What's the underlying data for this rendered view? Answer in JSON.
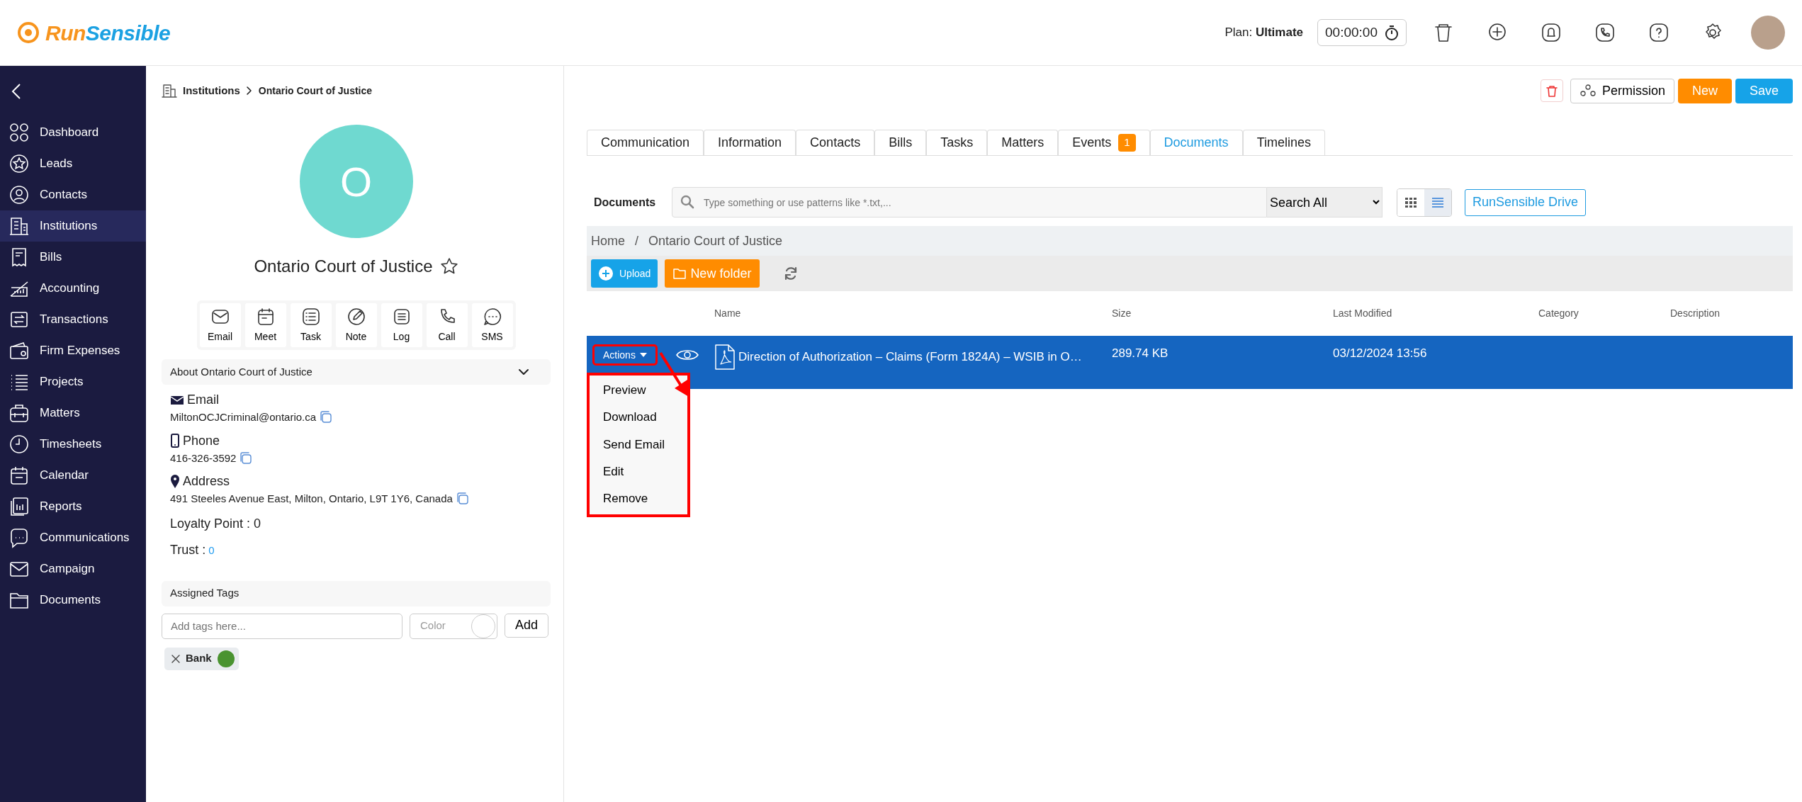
{
  "header": {
    "logo_parts": [
      {
        "text": "Run",
        "color": "#f7941d"
      },
      {
        "text": "Sensible",
        "color": "#1ba1e2"
      }
    ],
    "plan": "Plan: **Ultimate**",
    "timer": "00:00:00"
  },
  "sidebar": {
    "items": [
      {
        "label": "Dashboard",
        "selected": false
      },
      {
        "label": "Leads",
        "selected": false
      },
      {
        "label": "Contacts",
        "selected": false
      },
      {
        "label": "Institutions",
        "selected": true
      },
      {
        "label": "Bills",
        "selected": false
      },
      {
        "label": "Accounting",
        "selected": false
      },
      {
        "label": "Transactions",
        "selected": false
      },
      {
        "label": "Firm Expenses",
        "selected": false
      },
      {
        "label": "Projects",
        "selected": false
      },
      {
        "label": "Matters",
        "selected": false
      },
      {
        "label": "Timesheets",
        "selected": false
      },
      {
        "label": "Calendar",
        "selected": false
      },
      {
        "label": "Reports",
        "selected": false
      },
      {
        "label": "Communications",
        "selected": false
      },
      {
        "label": "Campaign",
        "selected": false
      },
      {
        "label": "Documents",
        "selected": false
      }
    ]
  },
  "breadcrumb": [
    "Institutions",
    "Ontario Court of Justice"
  ],
  "profile": {
    "initial": "O",
    "name": "Ontario Court of Justice",
    "quick_actions": [
      "Email",
      "Meet",
      "Task",
      "Note",
      "Log",
      "Call",
      "SMS"
    ],
    "about_title": "About Ontario Court of Justice",
    "fields": [
      {
        "kind": "email",
        "label": "Email",
        "value": "MiltonOCJCriminal@ontario.ca"
      },
      {
        "kind": "phone",
        "label": "Phone",
        "value": "416-326-3592"
      },
      {
        "kind": "address",
        "label": "Address",
        "value": "491 Steeles Avenue East, Milton, Ontario, L9T 1Y6, Canada"
      }
    ],
    "loyalty": "Loyalty Point : 0",
    "trust_label": "Trust :",
    "trust_value": "0",
    "tags_title": "Assigned Tags",
    "tag_placeholder": "Add tags here...",
    "color_placeholder": "Color",
    "add_button": "Add",
    "tags": [
      {
        "label": "Bank",
        "color": "#4a9330"
      }
    ]
  },
  "actions": {
    "permission": "Permission",
    "new": "New",
    "save": "Save"
  },
  "tabs": [
    {
      "label": "Communication",
      "selected": false
    },
    {
      "label": "Information",
      "selected": false
    },
    {
      "label": "Contacts",
      "selected": false
    },
    {
      "label": "Bills",
      "selected": false
    },
    {
      "label": "Tasks",
      "selected": false
    },
    {
      "label": "Matters",
      "selected": false
    },
    {
      "label": "Events",
      "selected": false,
      "badge": "1"
    },
    {
      "label": "Documents",
      "selected": true
    },
    {
      "label": "Timelines",
      "selected": false
    }
  ],
  "documents": {
    "label": "Documents",
    "search_placeholder": "Type something or use patterns like *.txt,...",
    "search_scope": "Search All",
    "views": [
      {
        "kind": "grid",
        "selected": false
      },
      {
        "kind": "list",
        "selected": true
      }
    ],
    "drive_button": "RunSensible Drive",
    "path": [
      "Home",
      "Ontario Court of Justice"
    ],
    "path_separator": "/",
    "upload": "Upload",
    "new_folder": "New folder",
    "columns": [
      "Name",
      "Size",
      "Last Modified",
      "Category",
      "Description"
    ],
    "rows": [
      {
        "name": "Direction of Authorization – Claims (Form 1824A) – WSIB in O…",
        "size": "289.74 KB",
        "modified": "03/12/2024 13:56",
        "selected": true
      }
    ],
    "actions_button": "Actions",
    "menu": [
      "Preview",
      "Download",
      "Send Email",
      "Edit",
      "Remove"
    ]
  }
}
